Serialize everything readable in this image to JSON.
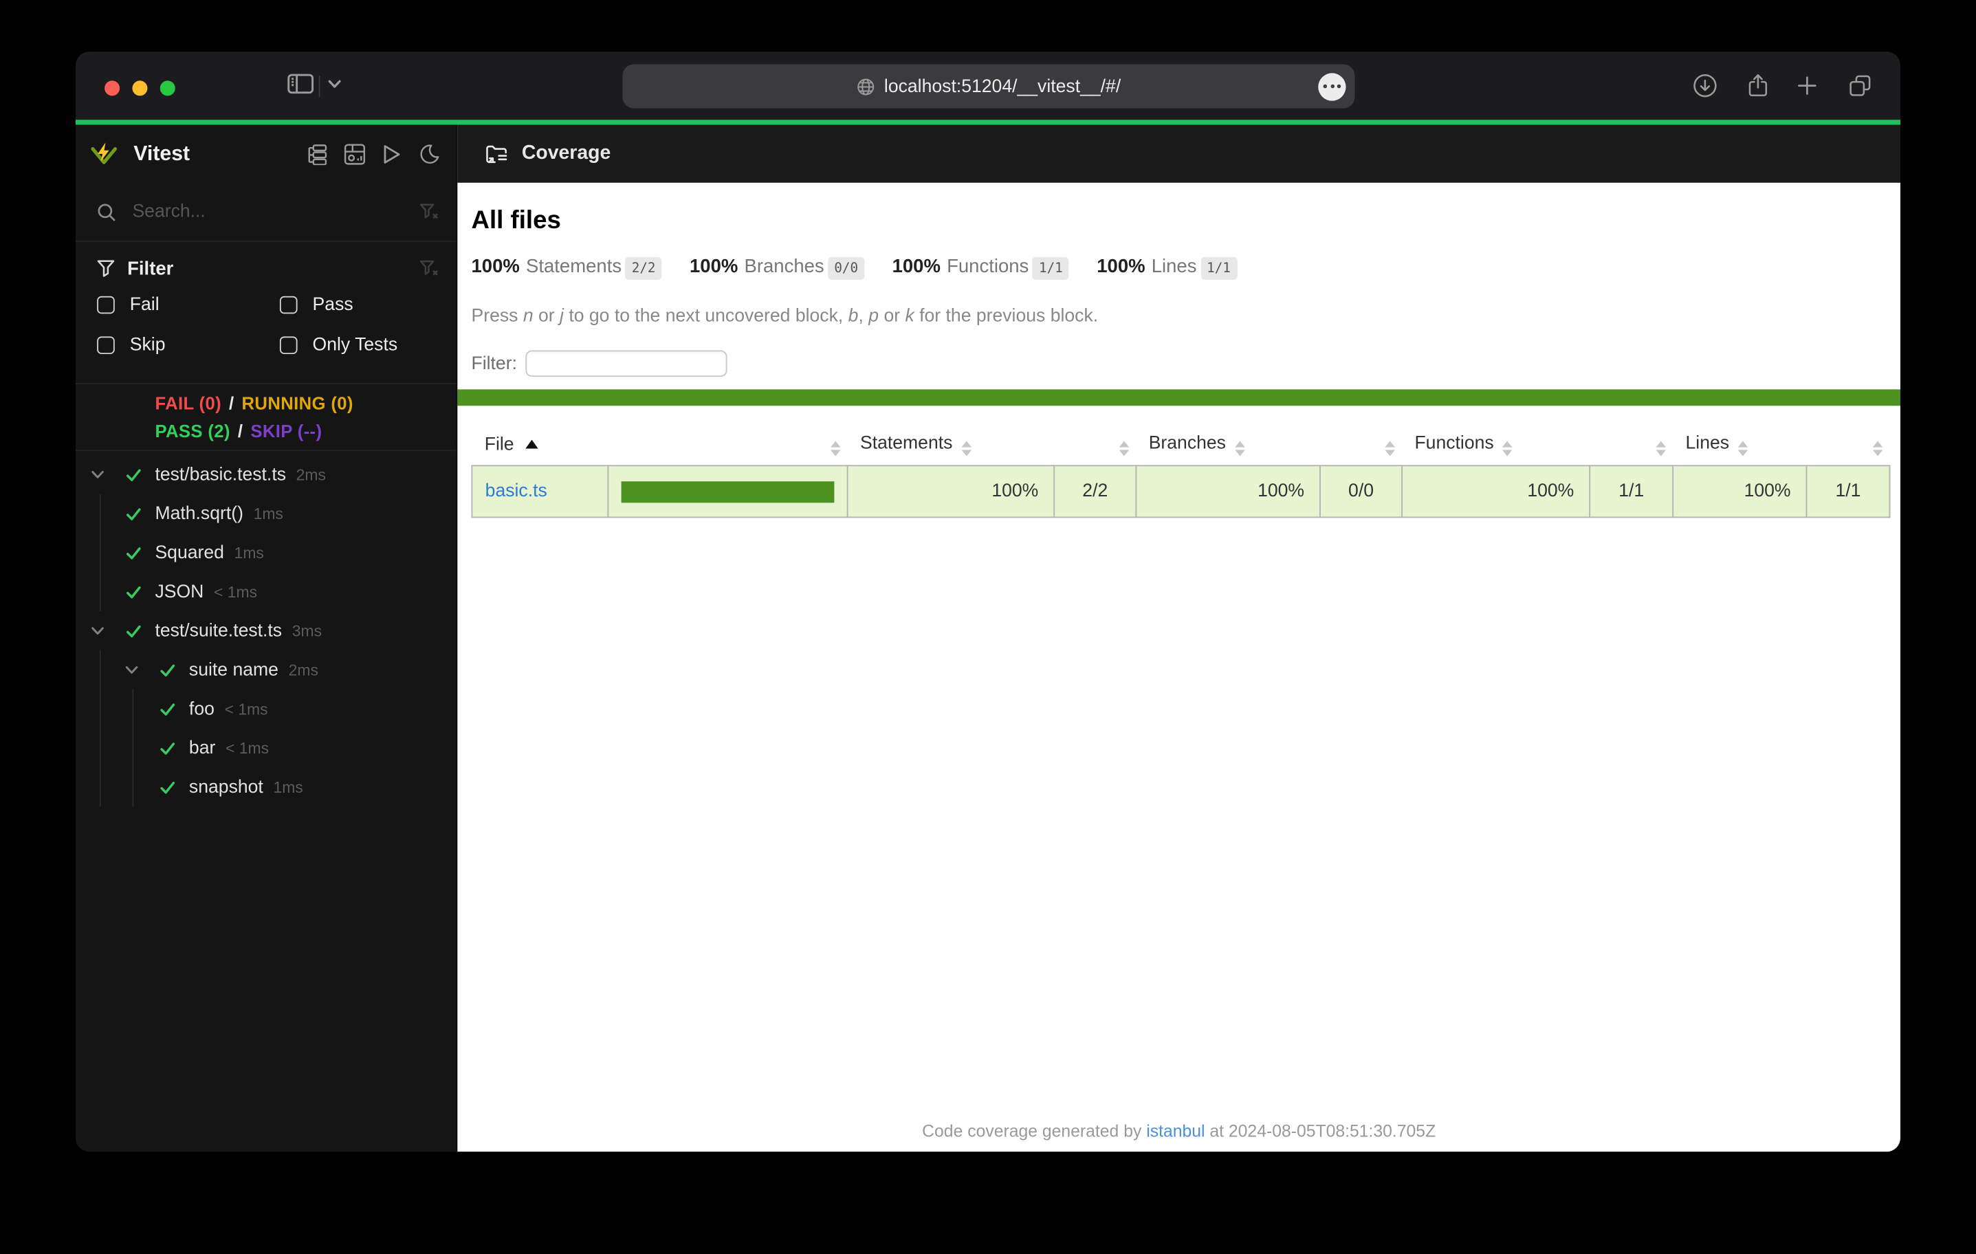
{
  "colors": {
    "traffic-red": "#ff5f57",
    "traffic-yellow": "#febc2e",
    "traffic-green": "#28c840",
    "progress-green": "#1ec05b",
    "cov-green": "#4d9221",
    "cov-row-bg": "#e6f5d0",
    "status-fail": "#f14c4c",
    "status-running": "#e0a60a",
    "status-pass": "#30d158",
    "status-skip": "#7d3fc9",
    "check-green": "#3cc964",
    "link-blue": "#2f7bd1",
    "footer-link": "#4a90e2",
    "brand-green": "#729b1b",
    "brand-yellow": "#fcc72b"
  },
  "browser": {
    "url": "localhost:51204/__vitest__/#/",
    "icons": [
      "sidebar-toggle",
      "chevron-down",
      "page-settings-ellipsis",
      "downloads",
      "share",
      "new-tab",
      "tab-overview"
    ]
  },
  "sidebar": {
    "brand": "Vitest",
    "header_icons": [
      "list-tree",
      "dashboard",
      "run-all",
      "dark-mode-moon"
    ],
    "search_placeholder": "Search...",
    "filter": {
      "title": "Filter",
      "options": [
        "Fail",
        "Pass",
        "Skip",
        "Only Tests"
      ]
    },
    "status": {
      "fail": "FAIL (0)",
      "sep": "/",
      "running": "RUNNING (0)",
      "pass": "PASS (2)",
      "skip": "SKIP (--)"
    },
    "tree": [
      {
        "label": "test/basic.test.ts",
        "duration": "2ms",
        "level": 0,
        "chevron": true
      },
      {
        "label": "Math.sqrt()",
        "duration": "1ms",
        "level": 1,
        "chevron": false
      },
      {
        "label": "Squared",
        "duration": "1ms",
        "level": 1,
        "chevron": false
      },
      {
        "label": "JSON",
        "duration": "< 1ms",
        "level": 1,
        "chevron": false
      },
      {
        "label": "test/suite.test.ts",
        "duration": "3ms",
        "level": 0,
        "chevron": true
      },
      {
        "label": "suite name",
        "duration": "2ms",
        "level": 1,
        "chevron": true
      },
      {
        "label": "foo",
        "duration": "< 1ms",
        "level": 2,
        "chevron": false
      },
      {
        "label": "bar",
        "duration": "< 1ms",
        "level": 2,
        "chevron": false
      },
      {
        "label": "snapshot",
        "duration": "1ms",
        "level": 2,
        "chevron": false
      }
    ]
  },
  "main": {
    "header": "Coverage",
    "all_files_label": "All files",
    "stats": [
      {
        "pct": "100%",
        "label": "Statements",
        "frac": "2/2"
      },
      {
        "pct": "100%",
        "label": "Branches",
        "frac": "0/0"
      },
      {
        "pct": "100%",
        "label": "Functions",
        "frac": "1/1"
      },
      {
        "pct": "100%",
        "label": "Lines",
        "frac": "1/1"
      }
    ],
    "hint_segments": [
      {
        "t": "Press "
      },
      {
        "t": "n",
        "i": true
      },
      {
        "t": " or "
      },
      {
        "t": "j",
        "i": true
      },
      {
        "t": " to go to the next uncovered block, "
      },
      {
        "t": "b",
        "i": true
      },
      {
        "t": ", "
      },
      {
        "t": "p",
        "i": true
      },
      {
        "t": " or "
      },
      {
        "t": "k",
        "i": true
      },
      {
        "t": " for the previous block."
      }
    ],
    "filter_label": "Filter:",
    "table": {
      "columns": [
        {
          "label": "File",
          "kind": "file",
          "sort": "asc"
        },
        {
          "label": "",
          "kind": "bar"
        },
        {
          "label": "Statements",
          "kind": "pct"
        },
        {
          "label": "",
          "kind": "frac"
        },
        {
          "label": "Branches",
          "kind": "pct"
        },
        {
          "label": "",
          "kind": "frac"
        },
        {
          "label": "Functions",
          "kind": "pct"
        },
        {
          "label": "",
          "kind": "frac"
        },
        {
          "label": "Lines",
          "kind": "pct"
        },
        {
          "label": "",
          "kind": "frac"
        }
      ],
      "rows": [
        {
          "file": "basic.ts",
          "bar_pct": 100,
          "cells": [
            "100%",
            "2/2",
            "100%",
            "0/0",
            "100%",
            "1/1",
            "100%",
            "1/1"
          ]
        }
      ]
    },
    "footer": {
      "prefix": "Code coverage generated by ",
      "link_label": "istanbul",
      "suffix": " at 2024-08-05T08:51:30.705Z"
    }
  }
}
